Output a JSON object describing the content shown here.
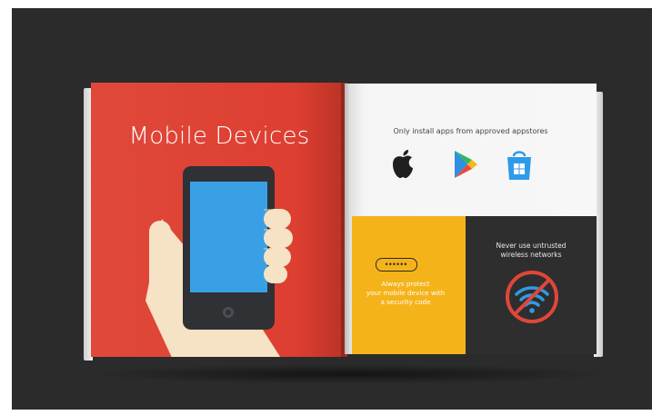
{
  "left_page": {
    "title": "Mobile Devices",
    "background_color": "#dd3f31"
  },
  "right_page": {
    "heading": "Only install apps from approved appstores",
    "stores": [
      {
        "name": "apple-icon"
      },
      {
        "name": "google-play-icon"
      },
      {
        "name": "windows-store-icon"
      }
    ],
    "security_panel": {
      "code_dots": "••••••",
      "line1": "Always protect",
      "line2": "your mobile device with",
      "line3": "a security code",
      "background_color": "#f5b31a"
    },
    "wifi_panel": {
      "line1": "Never use untrusted",
      "line2": "wireless networks",
      "background_color": "#2e2e2e",
      "icon": "no-wifi-icon"
    }
  }
}
